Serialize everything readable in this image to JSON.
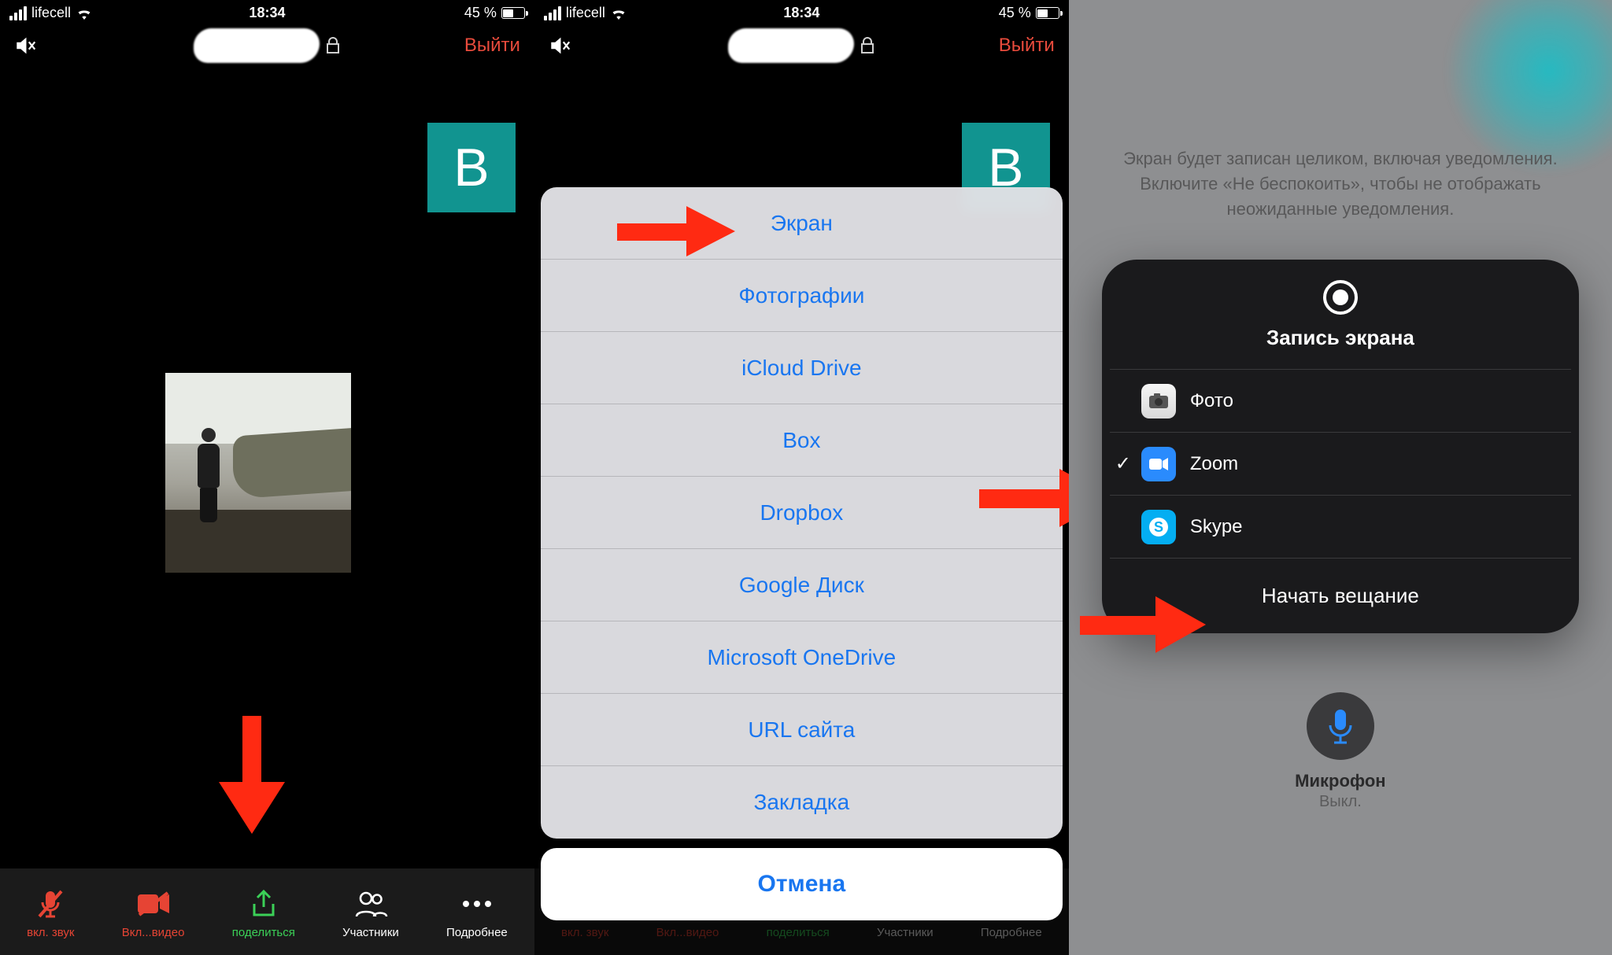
{
  "status": {
    "carrier": "lifecell",
    "time": "18:34",
    "battery_text": "45 %",
    "battery_fill": 45
  },
  "zoom_top": {
    "exit": "Выйти"
  },
  "participant_initial": "B",
  "toolbar": {
    "audio": {
      "label": "вкл. звук"
    },
    "video": {
      "label": "Вкл...видео"
    },
    "share": {
      "label": "поделиться"
    },
    "people": {
      "label": "Участники"
    },
    "more": {
      "label": "Подробнее"
    }
  },
  "sheet": {
    "items": [
      "Экран",
      "Фотографии",
      "iCloud Drive",
      "Box",
      "Dropbox",
      "Google Диск",
      "Microsoft OneDrive",
      "URL сайта",
      "Закладка"
    ],
    "cancel": "Отмена"
  },
  "broadcast": {
    "hint": "Экран будет записан целиком, включая уведомления. Включите «Не беспокоить», чтобы не отображать неожиданные уведомления.",
    "title": "Запись экрана",
    "apps": {
      "photo": "Фото",
      "zoom": "Zoom",
      "skype": "Skype"
    },
    "start": "Начать вещание",
    "mic_label": "Микрофон",
    "mic_state": "Выкл."
  }
}
